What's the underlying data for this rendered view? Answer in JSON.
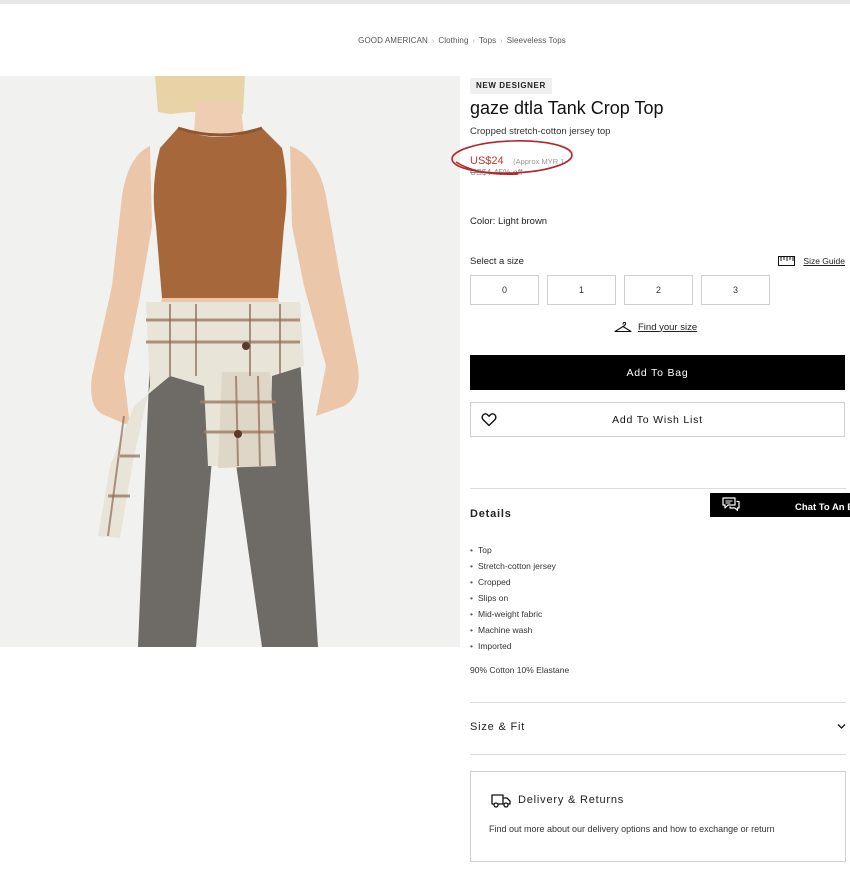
{
  "breadcrumb": {
    "items": [
      "GOOD AMERICAN",
      "Clothing",
      "Tops",
      "Sleeveless Tops"
    ],
    "separator": "›"
  },
  "product": {
    "badge": "NEW DESIGNER",
    "title": "gaze dtla Tank Crop Top",
    "subtitle": "Cropped stretch-cotton jersey top",
    "price": "US$24",
    "price_approx": "(Approx MYR 1",
    "price_was": "US$4",
    "price_discount": "45% off",
    "color_label": "Color: Light brown",
    "image_alt": "Model wearing a light brown cropped tank top with a plaid shirt tied at the waist and grey jeans"
  },
  "size": {
    "label": "Select a size",
    "guide_label": "Size Guide",
    "options": [
      "0",
      "1",
      "2",
      "3"
    ],
    "find_label": "Find your size"
  },
  "actions": {
    "add_to_bag": "Add To Bag",
    "add_to_wishlist": "Add To Wish List"
  },
  "details": {
    "heading": "Details",
    "items": [
      "Top",
      "Stretch-cotton jersey",
      "Cropped",
      "Slips on",
      "Mid-weight fabric",
      "Machine wash",
      "Imported"
    ],
    "composition": "90% Cotton 10% Elastane"
  },
  "size_fit": {
    "heading": "Size & Fit"
  },
  "delivery": {
    "heading": "Delivery & Returns",
    "text": "Find out more about our delivery options and how to exchange or return"
  },
  "chat": {
    "label": "Chat To An E"
  },
  "colors": {
    "price": "#c0392b",
    "annotation": "#b3262c",
    "tank": "#a6683a",
    "denim": "#6e6a66"
  },
  "icons": {
    "wishlist": "heart-icon",
    "size_guide": "ruler-icon",
    "find_size": "hanger-icon",
    "delivery": "truck-icon",
    "chat": "chat-bubble-icon",
    "size_fit": "chevron-down-icon"
  }
}
